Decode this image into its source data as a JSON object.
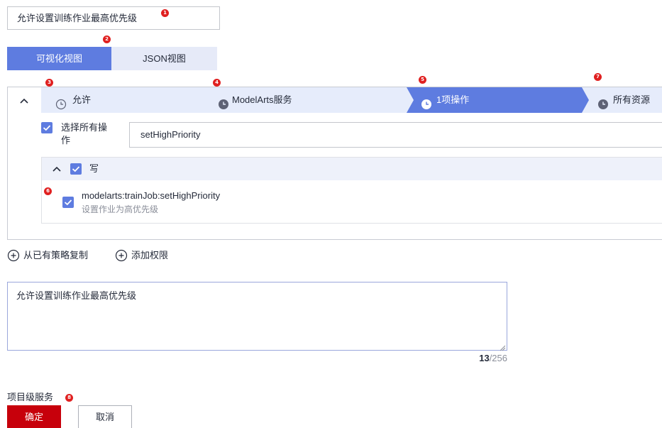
{
  "policy_name": "允许设置训练作业最高优先级",
  "view_tabs": {
    "visual": "可视化视图",
    "json": "JSON视图"
  },
  "steps": [
    {
      "label": "允许",
      "marker": "3"
    },
    {
      "label": "ModelArts服务",
      "marker": "4"
    },
    {
      "label": "1项操作",
      "marker": "5"
    },
    {
      "label": "所有资源",
      "marker": "7"
    }
  ],
  "select_all": {
    "label_line1": "选择所有操",
    "label_line2": "作",
    "checked": true
  },
  "action_search": {
    "value": "setHighPriority"
  },
  "group": {
    "label": "写",
    "checked": true
  },
  "action_item": {
    "name": "modelarts:trainJob:setHighPriority",
    "description": "设置作业为高优先级",
    "checked": true,
    "marker": "6"
  },
  "links": {
    "copy_from_policy": "从已有策略复制",
    "add_permission": "添加权限"
  },
  "description_field": {
    "value": "允许设置训练作业最高优先级",
    "count": "13",
    "max": "/256"
  },
  "scope": {
    "label": "项目级服务",
    "marker": "8"
  },
  "buttons": {
    "confirm": "确定",
    "cancel": "取消"
  },
  "markers": {
    "name_input": "1",
    "view_tabs": "2"
  },
  "colors": {
    "primary": "#5e7ce0",
    "danger": "#c7000b",
    "marker": "#e02020",
    "step_bg": "#e6ecfb"
  }
}
